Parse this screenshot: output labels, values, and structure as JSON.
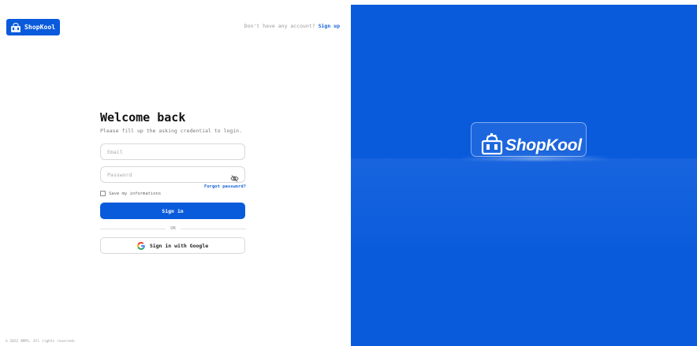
{
  "brand": {
    "name": "ShopKool",
    "hero_name": "ShopKool"
  },
  "header": {
    "signup_prompt": "Don't have any account?",
    "signup_link": "Sign up"
  },
  "form": {
    "title": "Welcome back",
    "subtitle": "Please fill up the asking credential to login.",
    "email_placeholder": "Email",
    "password_placeholder": "Password",
    "forgot_label": "Forgot password?",
    "remember_label": "Save my informations",
    "remember_checked": false,
    "signin_label": "Sign in",
    "or_label": "OR",
    "google_label": "Sign in with Google"
  },
  "footer": {
    "copyright": "© 2022 AMPS. All rights reserved."
  },
  "icons": {
    "logo": "shopping-bag-icon",
    "password_toggle": "eye-off-icon",
    "google": "google-icon"
  },
  "colors": {
    "primary": "#0a5bdc",
    "link": "#1565d8",
    "background": "#ffffff"
  }
}
